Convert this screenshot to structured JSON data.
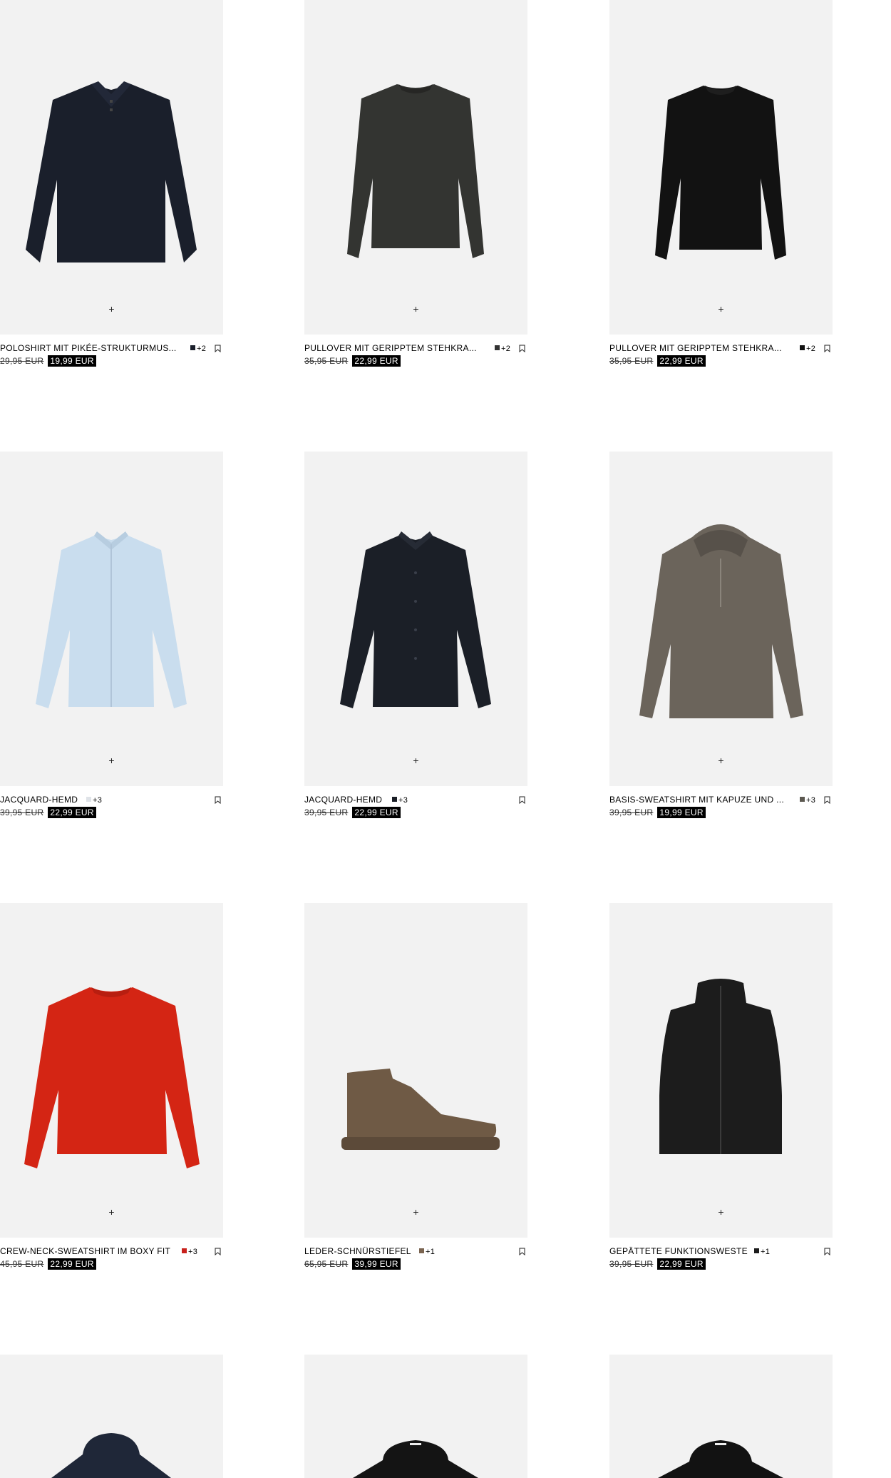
{
  "products": [
    {
      "name": "POLOSHIRT MIT PIKÉE-STRUKTURMUS...",
      "swatch_color": "#1a1f2b",
      "more_colors": "+2",
      "old_price": "29,95 EUR",
      "new_price": "19,99 EUR",
      "icon": "bookmark-icon"
    },
    {
      "name": "PULLOVER MIT GERIPPTEM STEHKRA...",
      "swatch_color": "#333333",
      "more_colors": "+2",
      "old_price": "35,95 EUR",
      "new_price": "22,99 EUR",
      "icon": "bookmark-icon"
    },
    {
      "name": "PULLOVER MIT GERIPPTEM STEHKRA...",
      "swatch_color": "#111111",
      "more_colors": "+2",
      "old_price": "35,95 EUR",
      "new_price": "22,99 EUR",
      "icon": "bookmark-icon"
    },
    {
      "name": "JACQUARD-HEMD",
      "swatch_color": "#dfe3e8",
      "more_colors": "+3",
      "old_price": "39,95 EUR",
      "new_price": "22,99 EUR",
      "icon": "bookmark-icon"
    },
    {
      "name": "JACQUARD-HEMD",
      "swatch_color": "#1b1f27",
      "more_colors": "+3",
      "old_price": "39,95 EUR",
      "new_price": "22,99 EUR",
      "icon": "bookmark-icon"
    },
    {
      "name": "BASIS-SWEATSHIRT MIT KAPUZE UND ...",
      "swatch_color": "#5c5850",
      "more_colors": "+3",
      "old_price": "39,95 EUR",
      "new_price": "19,99 EUR",
      "icon": "bookmark-icon"
    },
    {
      "name": "CREW-NECK-SWEATSHIRT IM BOXY FIT",
      "swatch_color": "#c8211c",
      "more_colors": "+3",
      "old_price": "45,95 EUR",
      "new_price": "22,99 EUR",
      "icon": "bookmark-icon"
    },
    {
      "name": "LEDER-SCHNÜRSTIEFEL",
      "swatch_color": "#7a6450",
      "more_colors": "+1",
      "old_price": "65,95 EUR",
      "new_price": "39,99 EUR",
      "icon": "bookmark-icon"
    },
    {
      "name": "GEPÄTTETE FUNKTIONSWESTE",
      "swatch_color": "#1c1c1c",
      "more_colors": "+1",
      "old_price": "39,95 EUR",
      "new_price": "22,99 EUR",
      "icon": "bookmark-icon"
    }
  ],
  "add_icon": "plus-icon",
  "add_glyph": "+"
}
